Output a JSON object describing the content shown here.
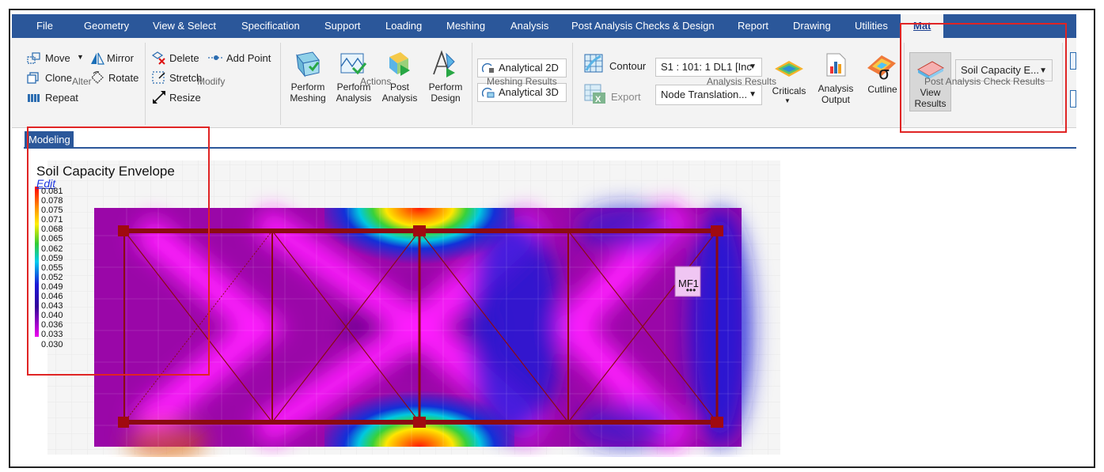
{
  "menu": {
    "items": [
      "File",
      "Geometry",
      "View & Select",
      "Specification",
      "Support",
      "Loading",
      "Meshing",
      "Analysis",
      "Post Analysis Checks & Design",
      "Report",
      "Drawing",
      "Utilities"
    ],
    "active": "Mat"
  },
  "ribbon": {
    "alter": {
      "move": "Move",
      "mirror": "Mirror",
      "clone": "Clone",
      "rotate": "Rotate",
      "repeat": "Repeat",
      "title": "Alter"
    },
    "modify": {
      "delete": "Delete",
      "add_point": "Add Point",
      "stretch": "Stretch",
      "resize": "Resize",
      "title": "Modify"
    },
    "actions": {
      "perform_meshing": [
        "Perform",
        "Meshing"
      ],
      "perform_analysis": [
        "Perform",
        "Analysis"
      ],
      "post_analysis": [
        "Post",
        "Analysis"
      ],
      "perform_design": [
        "Perform",
        "Design"
      ],
      "title": "Actions"
    },
    "meshing_results": {
      "analytical_2d": "Analytical 2D",
      "analytical_3d": "Analytical 3D",
      "title": "Meshing Results"
    },
    "analysis_results": {
      "contour": "Contour",
      "load_case": "S1 : 101: 1 DL1 [Inc",
      "export": "Export",
      "result_type": "Node Translation...",
      "criticals": "Criticals",
      "analysis_output": [
        "Analysis",
        "Output"
      ],
      "cutline": "Cutline",
      "title": "Analysis Results"
    },
    "post_analysis_check": {
      "view_results": [
        "View",
        "Results"
      ],
      "check_type": "Soil Capacity E...",
      "title": "Post Analysis Check Results"
    }
  },
  "tab": "Modeling",
  "viewport": {
    "title": "Soil Capacity Envelope",
    "edit_link": "Edit",
    "legend_values": [
      "0.081",
      "0.078",
      "0.075",
      "0.071",
      "0.068",
      "0.065",
      "0.062",
      "0.059",
      "0.055",
      "0.052",
      "0.049",
      "0.046",
      "0.043",
      "0.040",
      "0.036",
      "0.033",
      "0.030"
    ],
    "mat_label": "MF1"
  }
}
